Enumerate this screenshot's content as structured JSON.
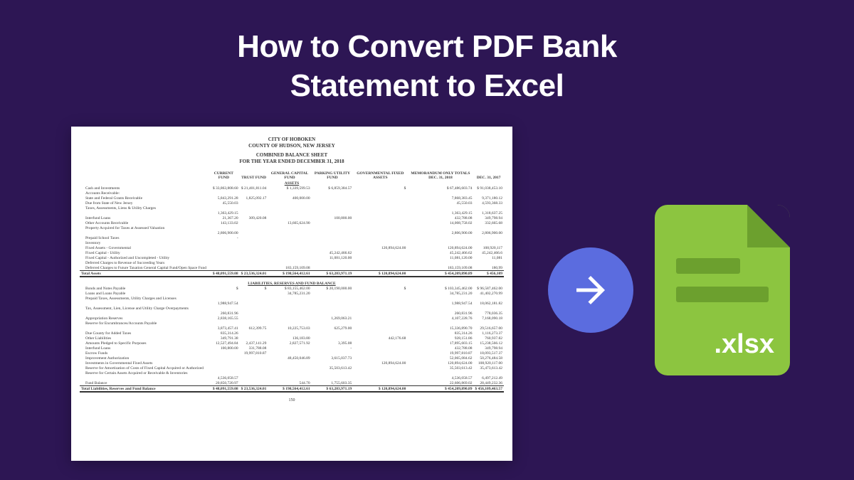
{
  "headline_line1": "How to Convert PDF Bank",
  "headline_line2": "Statement to Excel",
  "xlsx_label": ".xlsx",
  "doc": {
    "title1": "CITY OF HOBOKEN",
    "title2": "COUNTY OF HUDSON, NEW JERSEY",
    "title3": "COMBINED BALANCE SHEET",
    "title4": "FOR THE YEAR ENDED DECEMBER 31, 2018",
    "cols": [
      "",
      "CURRENT FUND",
      "TRUST FUND",
      "GENERAL CAPITAL FUND",
      "PARKING UTILITY FUND",
      "GOVERNMENTAL FIXED ASSETS",
      "MEMORANDUM ONLY TOTALS DEC. 31, 2018",
      "DEC. 31, 2017"
    ],
    "assets_label": "ASSETS",
    "asset_rows": [
      [
        "Cash and Investments",
        "$ 33,863,808.60",
        "$ 21,401,811.04",
        "$ 1,339,599.53",
        "$ 6,859,384.57",
        "$",
        "$ 67,486,603.74",
        "$ 91,038,453.10"
      ],
      [
        "Accounts Receivable:",
        "",
        "",
        "",
        "",
        "",
        "",
        ""
      ],
      [
        "State and Federal Grants Receivable",
        "5,843,291.28",
        "1,825,092.17",
        "400,000.00",
        "",
        "",
        "7,868,383.45",
        "9,371,180.12"
      ],
      [
        "Due from State of New Jersey",
        "45,550.03",
        "",
        "",
        "",
        "",
        "45,550.03",
        "4,593,368.33"
      ],
      [
        "Taxes, Assessments, Liens & Utility Charges",
        "",
        "",
        "",
        "",
        "",
        "",
        ""
      ],
      [
        "",
        "1,363,429.15",
        "",
        "",
        "",
        "",
        "1,363,429.15",
        "1,318,637.25"
      ],
      [
        "Interfund Loans",
        "21,367.20",
        "309,420.08",
        "",
        "100,800.00",
        "",
        "432,788.08",
        "349,798.94"
      ],
      [
        "Other Accounts Receivable",
        "143,133.02",
        "",
        "13,665,624.90",
        "",
        "",
        "14,008,758.02",
        "332,665.68"
      ],
      [
        "Property Acquired for Taxes at Assessed Valuation",
        "",
        "",
        "",
        "",
        "",
        "",
        ""
      ],
      [
        "",
        "2,806,900.00",
        "",
        "",
        "",
        "",
        "2,806,900.00",
        "2,806,900.00"
      ],
      [
        "Prepaid School Taxes",
        "-",
        "",
        "",
        "",
        "",
        "",
        ""
      ],
      [
        "Inventory",
        "",
        "",
        "",
        "",
        "",
        "",
        ""
      ],
      [
        "Fixed Assets - Governmental",
        "",
        "",
        "",
        "",
        "120,894,624.00",
        "120,894,624.00",
        "108,920,117"
      ],
      [
        "Fixed Capital - Utility",
        "",
        "",
        "",
        "45,242,466.62",
        "",
        "45,242,466.62",
        "45,242,466.6"
      ],
      [
        "Fixed Capital - Authorized and Uncompleted - Utility",
        "",
        "",
        "",
        "11,081,120.00",
        "",
        "11,081,120.00",
        "11,081"
      ],
      [
        "Deferred Charges to Revenue of Succeeding Years",
        "",
        "",
        "",
        "",
        "",
        "",
        ""
      ],
      [
        "Deferred Charges to Future Taxation General Capital Fund/Open Space Fund",
        "",
        "",
        "183,159,109.08",
        "",
        "",
        "183,159,109.08",
        "180,99"
      ]
    ],
    "total_assets": [
      "Total Assets",
      "$ 48,091,559.08",
      "$ 23,536,324.01",
      "$ 198,564,412.61",
      "$ 63,283,971.19",
      "$ 120,894,624.00",
      "$ 454,209,890.89",
      "$ 456,109"
    ],
    "liab_label": "LIABILITIES, RESERVES AND FUND BALANCE",
    "liab_rows": [
      [
        "Bonds and Notes Payable",
        "$",
        "$",
        "$ 83,155,462.00",
        "$ 20,190,000.00",
        "$",
        "$ 103,345,462.00",
        "$ 96,587,462.00"
      ],
      [
        "Loans and Loans Payable",
        "",
        "",
        "34,785,231.20",
        "",
        "",
        "34,785,231.20",
        "41,402,270.99"
      ],
      [
        "Prepaid Taxes, Assessments, Utility Charges and Licenses",
        "",
        "",
        "",
        "",
        "",
        "",
        ""
      ],
      [
        "",
        "1,988,947.54",
        "",
        "",
        "",
        "",
        "1,988,947.54",
        "18,062,181.82"
      ],
      [
        "Tax, Assessment, Lien, License and Utility Charge Overpayments",
        "",
        "",
        "",
        "",
        "",
        "",
        ""
      ],
      [
        "",
        "260,831.96",
        "",
        "",
        "",
        "",
        "260,831.96",
        "778,036.35"
      ],
      [
        "Appropriation Reserves",
        "2,838,165.55",
        "",
        "",
        "1,269,063.21",
        "",
        "4,107,228.76",
        "7,168,090.18"
      ],
      [
        "Reserve for Encumbrances/Accounts Payable",
        "",
        "",
        "",
        "",
        "",
        "",
        ""
      ],
      [
        "",
        "3,873,457.41",
        "612,399.75",
        "10,225,753.03",
        "625,279.00",
        "",
        "15,336,890.70",
        "29,516,657.00"
      ],
      [
        "Due County for Added Taxes",
        "835,314.26",
        "",
        "",
        "",
        "",
        "835,314.26",
        "1,116,273.37"
      ],
      [
        "Other Liabilities",
        "349,791.38",
        "",
        "136,183.80",
        "",
        "442,176.68",
        "928,151.86",
        "760,937.82"
      ],
      [
        "Amounts Pledged to Specific Purposes",
        "12,527,494.84",
        "2,437,141.29",
        "2,827,571.92",
        "3,395.08",
        "",
        "17,895,603.15",
        "15,238,566.12"
      ],
      [
        "Interfund Loans",
        "100,800.00",
        "331,788.08",
        "",
        "-",
        "",
        "432,788.08",
        "349,798.94"
      ],
      [
        "Escrow Funds",
        "",
        "19,997,810.87",
        "",
        "",
        "",
        "19,997,810.87",
        "18,093,517.37"
      ],
      [
        "Improvement Authorization",
        "",
        "",
        "48,450,046.89",
        "3,615,037.73",
        "",
        "52,065,084.62",
        "50,276,484.58"
      ],
      [
        "Investments in Governmental Fixed Assets",
        "",
        "",
        "",
        "",
        "120,894,624.00",
        "120,894,624.00",
        "108,920,117.00"
      ],
      [
        "Reserve for Amortization of Costs of Fixed Capital Acquired or Authorized",
        "",
        "",
        "",
        "35,503,613.42",
        "",
        "35,503,613.42",
        "35,473,613.42"
      ],
      [
        "Reserve for Certain Assets Acquired or Receivable & Inventories",
        "",
        "",
        "",
        "",
        "",
        "",
        ""
      ],
      [
        "",
        "4,536,058.57",
        "",
        "",
        "",
        "",
        "4,536,058.57",
        "6,497,212.49"
      ],
      [
        "Fund Balance",
        "20,850,720.97",
        "",
        "544.70",
        "1,755,603.35",
        "",
        "22,606,869.02",
        "28,449,232.36"
      ]
    ],
    "total_liab": [
      "Total Liabilities, Reserves and Fund Balance",
      "$ 48,091,559.08",
      "$ 23,536,324.01",
      "$ 198,564,412.61",
      "$ 63,283,971.19",
      "$ 120,894,624.00",
      "$ 454,209,890.89",
      "$ 456,109,463.57"
    ],
    "page_num": "150"
  }
}
